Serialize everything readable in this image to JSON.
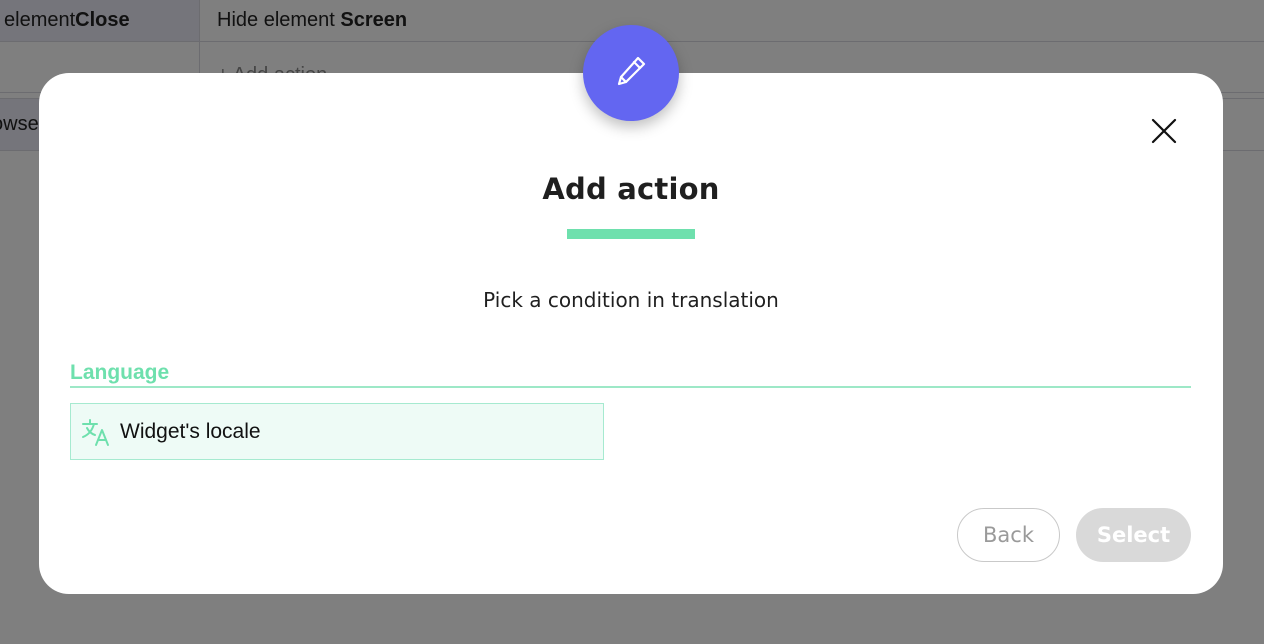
{
  "background": {
    "row1_left_prefix": "element ",
    "row1_left_bold": "Close",
    "row1_right_prefix": "Hide element ",
    "row1_right_bold": "Screen",
    "row2_add_action": "Add action",
    "row3_left_text": "owse"
  },
  "modal": {
    "icon": "pencil-icon",
    "title": "Add action",
    "subtitle": "Pick a condition in translation",
    "section_label": "Language",
    "options": [
      {
        "icon": "translate-icon",
        "label": "Widget's locale"
      }
    ],
    "back_label": "Back",
    "select_label": "Select"
  },
  "colors": {
    "accent": "#6366f1",
    "green": "#6ee0ad",
    "option_bg": "#eefbf6",
    "disabled_button": "#d9d9d9"
  }
}
